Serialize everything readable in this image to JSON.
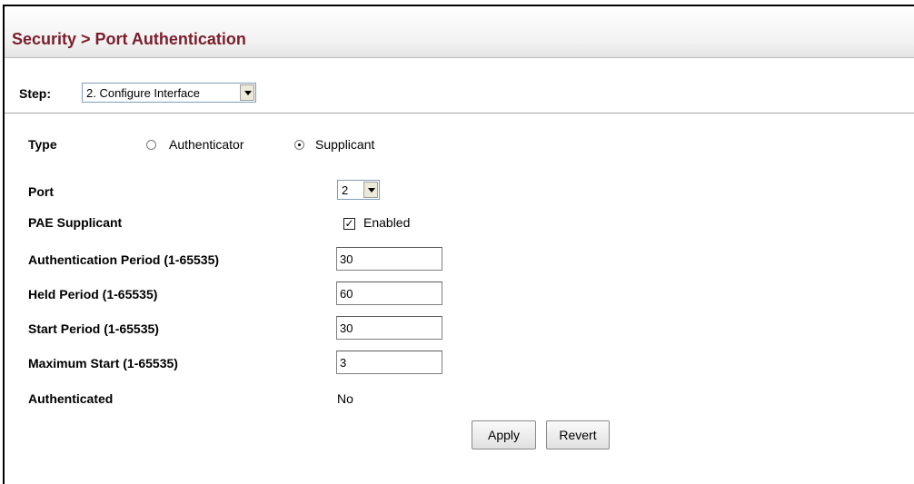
{
  "header": {
    "title": "Security > Port Authentication"
  },
  "step": {
    "label": "Step:",
    "selected": "2. Configure Interface"
  },
  "form": {
    "type": {
      "label": "Type",
      "options": [
        "Authenticator",
        "Supplicant"
      ],
      "selected": "Supplicant"
    },
    "port": {
      "label": "Port",
      "selected": "2"
    },
    "pae_supplicant": {
      "label": "PAE Supplicant",
      "checkbox_label": "Enabled",
      "checked": true
    },
    "authentication_period": {
      "label": "Authentication Period (1-65535)",
      "value": "30"
    },
    "held_period": {
      "label": "Held Period (1-65535)",
      "value": "60"
    },
    "start_period": {
      "label": "Start Period (1-65535)",
      "value": "30"
    },
    "maximum_start": {
      "label": "Maximum Start (1-65535)",
      "value": "3"
    },
    "authenticated": {
      "label": "Authenticated",
      "value": "No"
    }
  },
  "buttons": {
    "apply": "Apply",
    "revert": "Revert"
  },
  "colors": {
    "title": "#7a1e2c"
  }
}
